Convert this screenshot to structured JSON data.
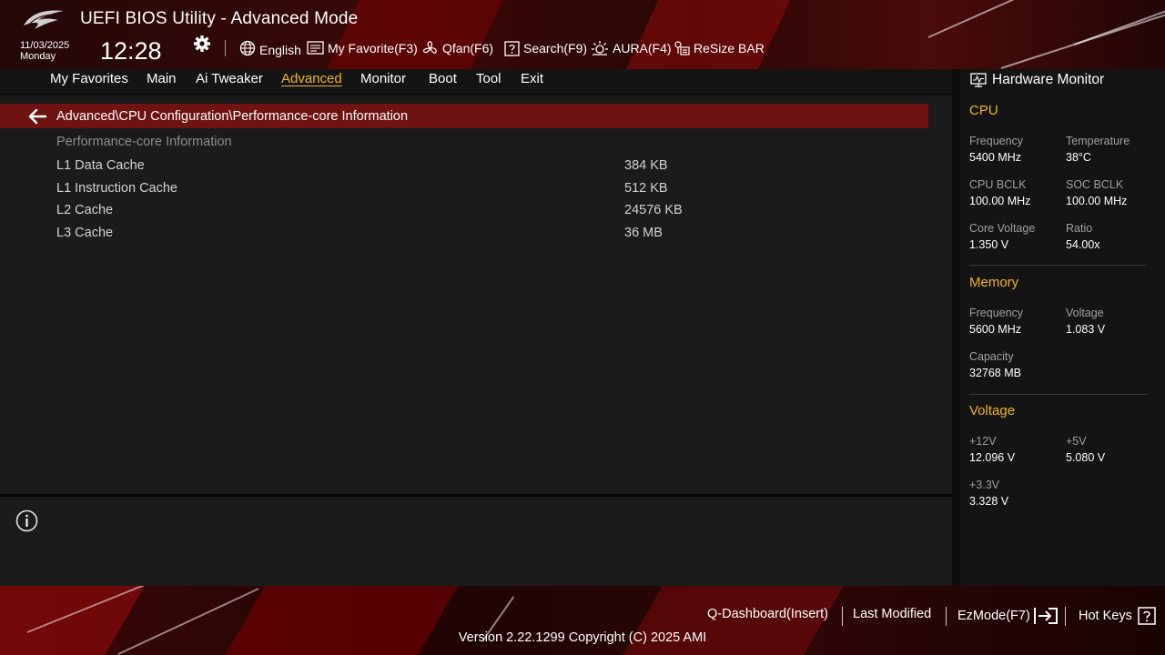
{
  "header": {
    "title": "UEFI BIOS Utility - Advanced Mode",
    "date": "11/03/2025",
    "day": "Monday",
    "time": "12:28",
    "tools": [
      {
        "label": "English",
        "icon": "globe-icon"
      },
      {
        "label": "My Favorite(F3)",
        "icon": "favorite-list-icon"
      },
      {
        "label": "Qfan(F6)",
        "icon": "fan-icon"
      },
      {
        "label": "Search(F9)",
        "icon": "search-question-icon"
      },
      {
        "label": "AURA(F4)",
        "icon": "aura-light-icon"
      },
      {
        "label": "ReSize BAR",
        "icon": "resize-bar-icon"
      }
    ]
  },
  "menu": {
    "items": [
      "My Favorites",
      "Main",
      "Ai Tweaker",
      "Advanced",
      "Monitor",
      "Boot",
      "Tool",
      "Exit"
    ],
    "active": "Advanced"
  },
  "main": {
    "breadcrumb": "Advanced\\CPU Configuration\\Performance-core Information",
    "section_title": "Performance-core Information",
    "rows": [
      {
        "label": "L1 Data Cache",
        "value": "384 KB"
      },
      {
        "label": "L1 Instruction Cache",
        "value": "512 KB"
      },
      {
        "label": "L2 Cache",
        "value": "24576 KB"
      },
      {
        "label": "L3 Cache",
        "value": "36 MB"
      }
    ]
  },
  "hardware_monitor": {
    "title": "Hardware Monitor",
    "cpu": {
      "heading": "CPU",
      "items": [
        {
          "label": "Frequency",
          "value": "5400 MHz"
        },
        {
          "label": "Temperature",
          "value": "38°C"
        },
        {
          "label": "CPU BCLK",
          "value": "100.00 MHz"
        },
        {
          "label": "SOC BCLK",
          "value": "100.00 MHz"
        },
        {
          "label": "Core Voltage",
          "value": "1.350 V"
        },
        {
          "label": "Ratio",
          "value": "54.00x"
        }
      ]
    },
    "memory": {
      "heading": "Memory",
      "items": [
        {
          "label": "Frequency",
          "value": "5600 MHz"
        },
        {
          "label": "Voltage",
          "value": "1.083 V"
        },
        {
          "label": "Capacity",
          "value": "32768 MB"
        }
      ]
    },
    "voltage": {
      "heading": "Voltage",
      "items": [
        {
          "label": "+12V",
          "value": "12.096 V"
        },
        {
          "label": "+5V",
          "value": "5.080 V"
        },
        {
          "label": "+3.3V",
          "value": "3.328 V"
        }
      ]
    }
  },
  "footer": {
    "q_dashboard": "Q-Dashboard(Insert)",
    "last_modified": "Last Modified",
    "ez_mode": "EzMode(F7)",
    "hot_keys": "Hot Keys",
    "version": "Version 2.22.1299 Copyright (C) 2025 AMI"
  },
  "colors": {
    "accent": "#f0b61e",
    "highlight_bar": "#6e1212",
    "panel": "#1b1b1b"
  }
}
